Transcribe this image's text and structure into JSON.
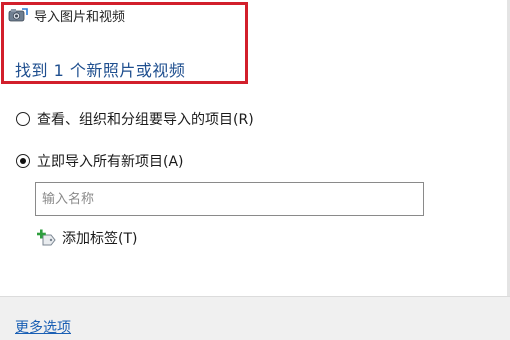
{
  "dialog": {
    "title": "导入图片和视频",
    "found_text": "找到 1 个新照片或视频"
  },
  "options": {
    "review": {
      "label": "查看、组织和分组要导入的项目(R)",
      "selected": false
    },
    "import_all": {
      "label": "立即导入所有新项目(A)",
      "selected": true
    }
  },
  "name_input": {
    "placeholder": "输入名称",
    "value": ""
  },
  "add_tags": {
    "label": "添加标签(T)"
  },
  "footer": {
    "more_options_label": "更多选项"
  },
  "colors": {
    "highlight_border": "#d21f2b",
    "found_text": "#1f4f8f",
    "link": "#1a5fb4"
  },
  "icons": {
    "app": "camera-import-icon",
    "tag": "add-tag-icon"
  }
}
